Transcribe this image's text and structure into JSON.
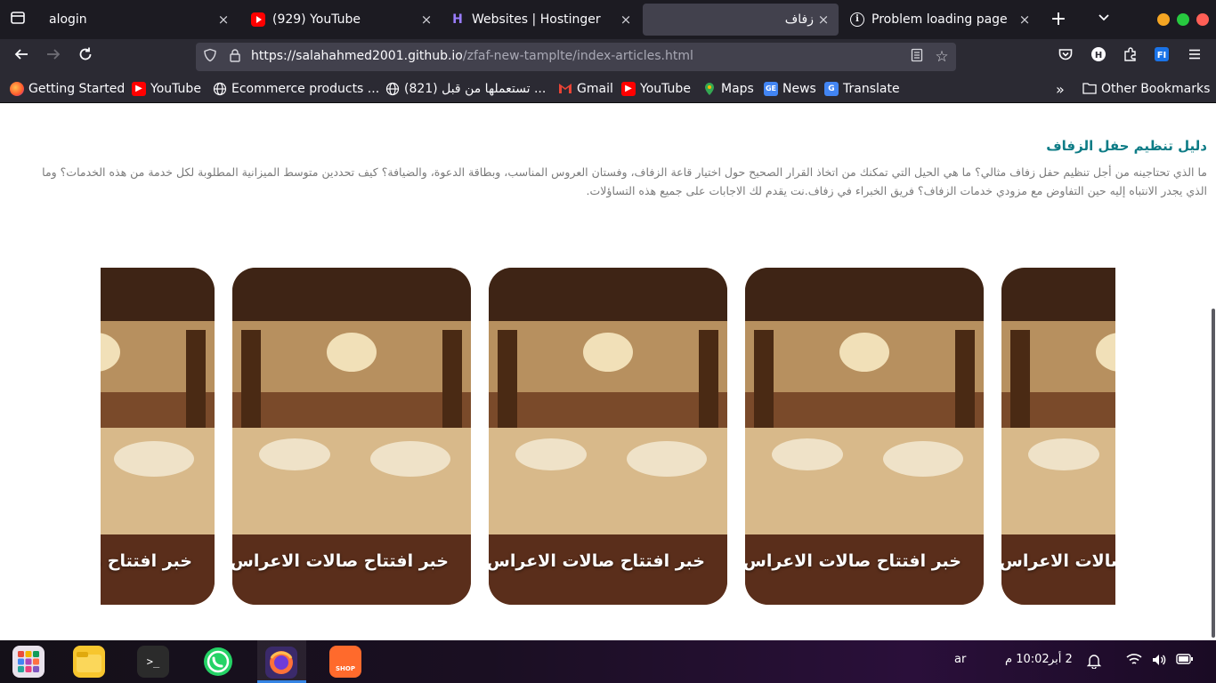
{
  "browser": {
    "tabs": [
      {
        "title": "alogin",
        "favicon": "tab-list-icon",
        "active": false
      },
      {
        "title": "(929) YouTube",
        "favicon": "youtube-icon",
        "active": false
      },
      {
        "title": "Websites | Hostinger",
        "favicon": "hostinger-icon",
        "active": false
      },
      {
        "title": "زفاف",
        "favicon": "none",
        "active": true
      },
      {
        "title": "Problem loading page",
        "favicon": "info-icon",
        "active": false
      }
    ],
    "close_glyph": "×",
    "url": {
      "host": "https://salahahmed2001.github.io",
      "path": "/zfaf-new-tamplte/index-articles.html"
    },
    "bookmarks": [
      {
        "label": "Getting Started",
        "icon": "firefox-icon"
      },
      {
        "label": "YouTube",
        "icon": "youtube-icon"
      },
      {
        "label": "Ecommerce products ...",
        "icon": "globe-icon"
      },
      {
        "label": "(821) تستعملها من قبل ...",
        "icon": "globe-icon"
      },
      {
        "label": "Gmail",
        "icon": "gmail-icon"
      },
      {
        "label": "YouTube",
        "icon": "youtube-icon"
      },
      {
        "label": "Maps",
        "icon": "maps-icon"
      },
      {
        "label": "News",
        "icon": "news-icon"
      },
      {
        "label": "Translate",
        "icon": "translate-icon"
      }
    ],
    "other_bookmarks": "Other Bookmarks",
    "colors": {
      "tabstrip": "#1c1b22",
      "toolbar": "#2b2a33",
      "urlbar": "#42414d"
    }
  },
  "article": {
    "title": "دليل تنظيم حفل الزفاف",
    "body": "ما الذي تحتاجينه من أجل تنظيم حفل زفاف مثالي؟ ما هي الحيل التي تمكنك من اتخاذ القرار الصحيح حول اختيار قاعة الزفاف، وفستان العروس المناسب، وبطاقة الدعوة، والضيافة؟ كيف تحددين متوسط الميزانية المطلوبة لكل خدمة من هذه الخدمات؟ وما الذي يجدر الانتباه إليه حين التفاوض مع مزودي خدمات الزفاف؟ فريق الخبراء في زفاف.نت يقدم لك الاجابات على جميع هذه التساؤلات.",
    "accent_color": "#0e7c86"
  },
  "cards": [
    {
      "title": "خبر افتتاح صالات الاعراس"
    },
    {
      "title": "خبر افتتاح صالات الاعراس"
    },
    {
      "title": "خبر افتتاح صالات الاعراس"
    },
    {
      "title": "خبر افتتاح صالات الاعراس"
    },
    {
      "title": "خبر افتتاح صالات الاعراس"
    }
  ],
  "taskbar": {
    "apps": [
      "app-grid-icon",
      "files-icon",
      "terminal-icon",
      "whatsapp-icon",
      "firefox-icon",
      "shop-icon"
    ],
    "terminal_glyph": ">_",
    "shop_label": "SHOP",
    "language": "ar",
    "date": "2 أبر",
    "time": "10:02 م"
  }
}
